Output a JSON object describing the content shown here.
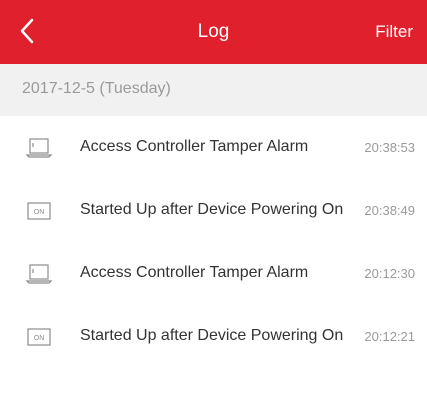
{
  "header": {
    "title": "Log",
    "filter_label": "Filter",
    "back_icon": "chevron-left-icon",
    "background_color": "#e0202c"
  },
  "date_header": "2017-12-5 (Tuesday)",
  "logs": [
    {
      "icon": "laptop-icon",
      "text": "Access Controller Tamper Alarm",
      "time": "20:38:53"
    },
    {
      "icon": "power-on-icon",
      "icon_text": "ON",
      "text": "Started Up after Device Powering On",
      "time": "20:38:49"
    },
    {
      "icon": "laptop-icon",
      "text": "Access Controller Tamper Alarm",
      "time": "20:12:30"
    },
    {
      "icon": "power-on-icon",
      "icon_text": "ON",
      "text": "Started Up after Device Powering On",
      "time": "20:12:21"
    }
  ]
}
